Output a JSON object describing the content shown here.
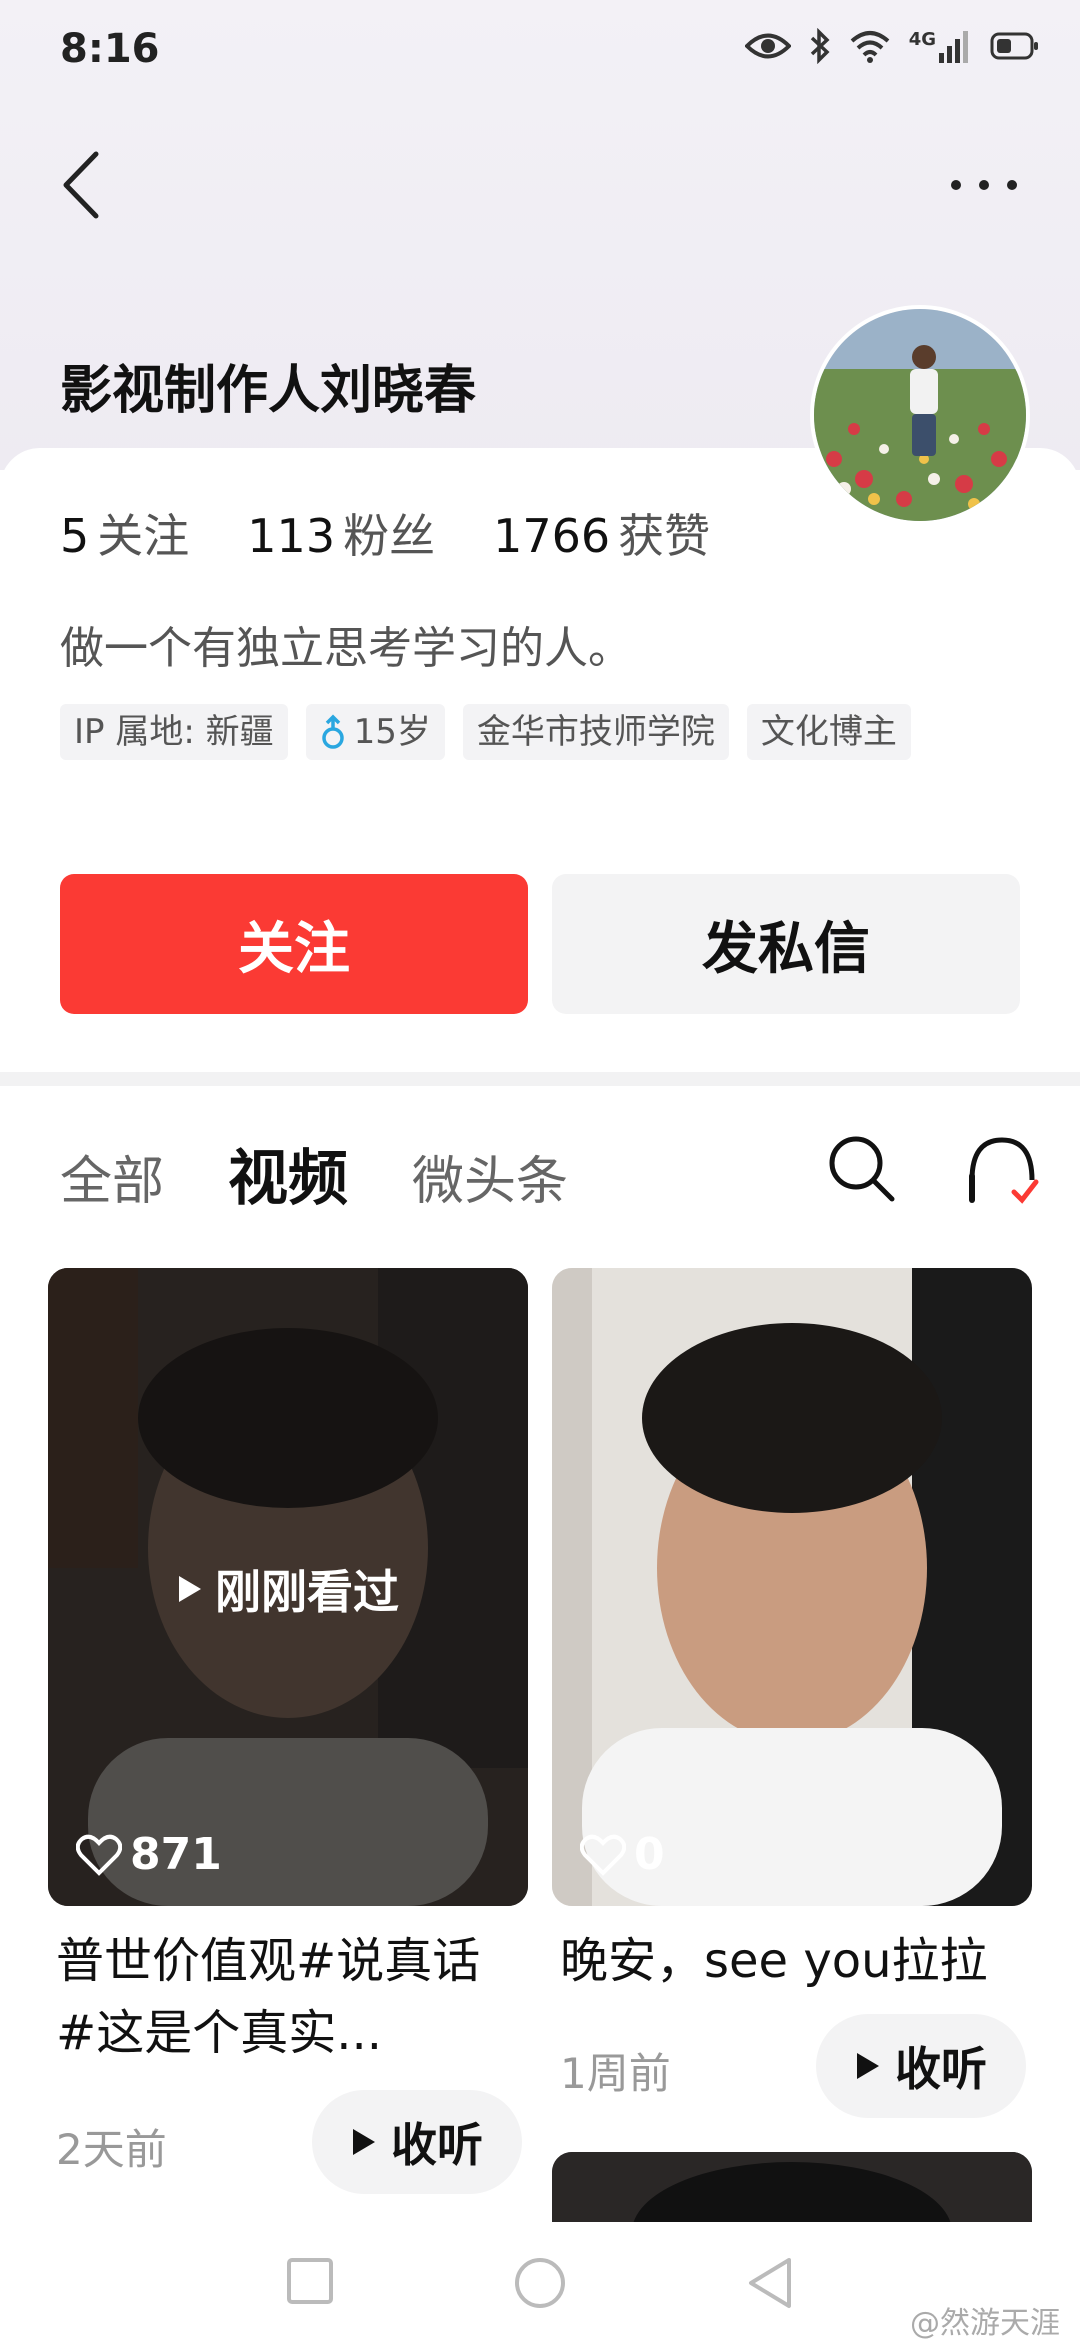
{
  "status_bar": {
    "time": "8:16",
    "network": "4G"
  },
  "profile": {
    "name": "影视制作人刘晓春",
    "stats": [
      {
        "num": "5",
        "label": "关注"
      },
      {
        "num": "113",
        "label": "粉丝"
      },
      {
        "num": "1766",
        "label": "获赞"
      }
    ],
    "bio": "做一个有独立思考学习的人。",
    "tags": {
      "ip": "IP 属地: 新疆",
      "age": "15岁",
      "school": "金华市技师学院",
      "role": "文化博主"
    },
    "follow_label": "关注",
    "message_label": "发私信"
  },
  "tabs": [
    {
      "label": "全部",
      "active": false
    },
    {
      "label": "视频",
      "active": true
    },
    {
      "label": "微头条",
      "active": false
    }
  ],
  "videos": [
    {
      "likes": "871",
      "overlay": "刚刚看过",
      "title": "普世价值观#说真话 #这是个真实...",
      "time": "2天前",
      "listen": "收听"
    },
    {
      "likes": "0",
      "title": "晚安，see you拉拉",
      "time": "1周前",
      "listen": "收听"
    }
  ],
  "watermark": "@然游天涯",
  "colors": {
    "accent": "#fb3a34",
    "gender_icon": "#2aa7e0"
  }
}
